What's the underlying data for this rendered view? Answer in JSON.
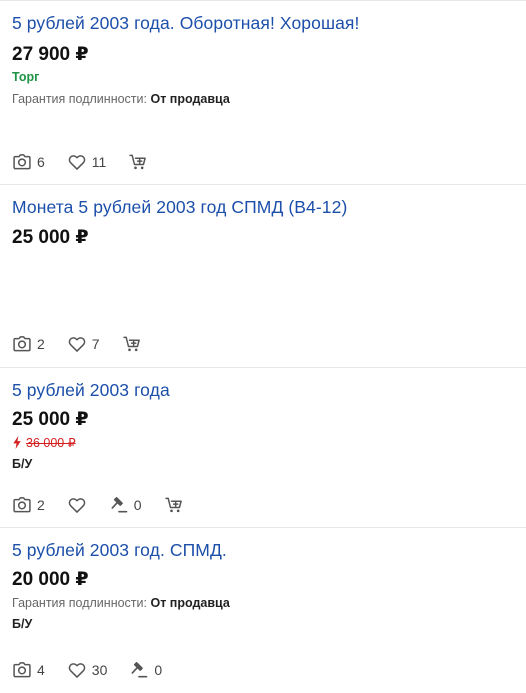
{
  "listings": [
    {
      "title": "5 рублей 2003 года. Оборотная! Хорошая!",
      "price": "27 900 ₽",
      "bargain": "Торг",
      "authenticity_label": "Гарантия подлинности:",
      "authenticity_value": "От продавца",
      "photos": "6",
      "likes": "11"
    },
    {
      "title": "Монета 5 рублей 2003 год СПМД (В4-12)",
      "price": "25 000 ₽",
      "photos": "2",
      "likes": "7"
    },
    {
      "title": "5 рублей 2003 года",
      "price": "25 000 ₽",
      "old_price": "36 000 ₽",
      "condition": "Б/У",
      "photos": "2",
      "bids": "0"
    },
    {
      "title": "5 рублей 2003 год. СПМД.",
      "price": "20 000 ₽",
      "authenticity_label": "Гарантия подлинности:",
      "authenticity_value": "От продавца",
      "condition": "Б/У",
      "photos": "4",
      "likes": "30",
      "bids": "0"
    }
  ],
  "icons": {
    "photo": "camera-icon",
    "like": "heart-icon",
    "bid": "auction-hammer-icon",
    "cart": "add-to-cart-icon",
    "discount": "lightning-icon"
  },
  "colors": {
    "title": "#1c4faa",
    "bargain": "#1f9445",
    "old_price": "#d32121",
    "divider": "#e6e6e6"
  }
}
